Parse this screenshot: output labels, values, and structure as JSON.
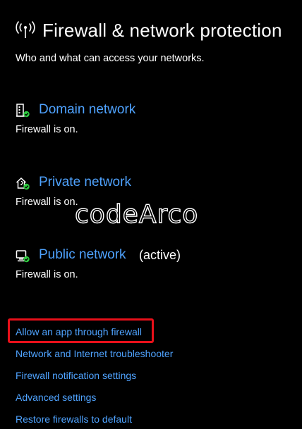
{
  "header": {
    "title": "Firewall & network protection",
    "subtitle": "Who and what can access your networks.",
    "icon": "wireless-antenna-icon"
  },
  "networks": [
    {
      "name": "Domain network",
      "status": "Firewall is on.",
      "active_label": "",
      "icon": "domain-building-icon",
      "badge_color": "#2ecc40"
    },
    {
      "name": "Private network",
      "status": "Firewall is on.",
      "active_label": "",
      "icon": "private-home-icon",
      "badge_color": "#2ecc40"
    },
    {
      "name": "Public network",
      "status": "Firewall is on.",
      "active_label": "(active)",
      "icon": "public-computer-icon",
      "badge_color": "#2ecc40"
    }
  ],
  "links": [
    "Allow an app through firewall",
    "Network and Internet troubleshooter",
    "Firewall notification settings",
    "Advanced settings",
    "Restore firewalls to default"
  ],
  "watermark": "codeArco",
  "colors": {
    "background": "#000000",
    "link": "#4fa3ff",
    "highlight": "#e8101a",
    "status_ok": "#2ecc40"
  }
}
